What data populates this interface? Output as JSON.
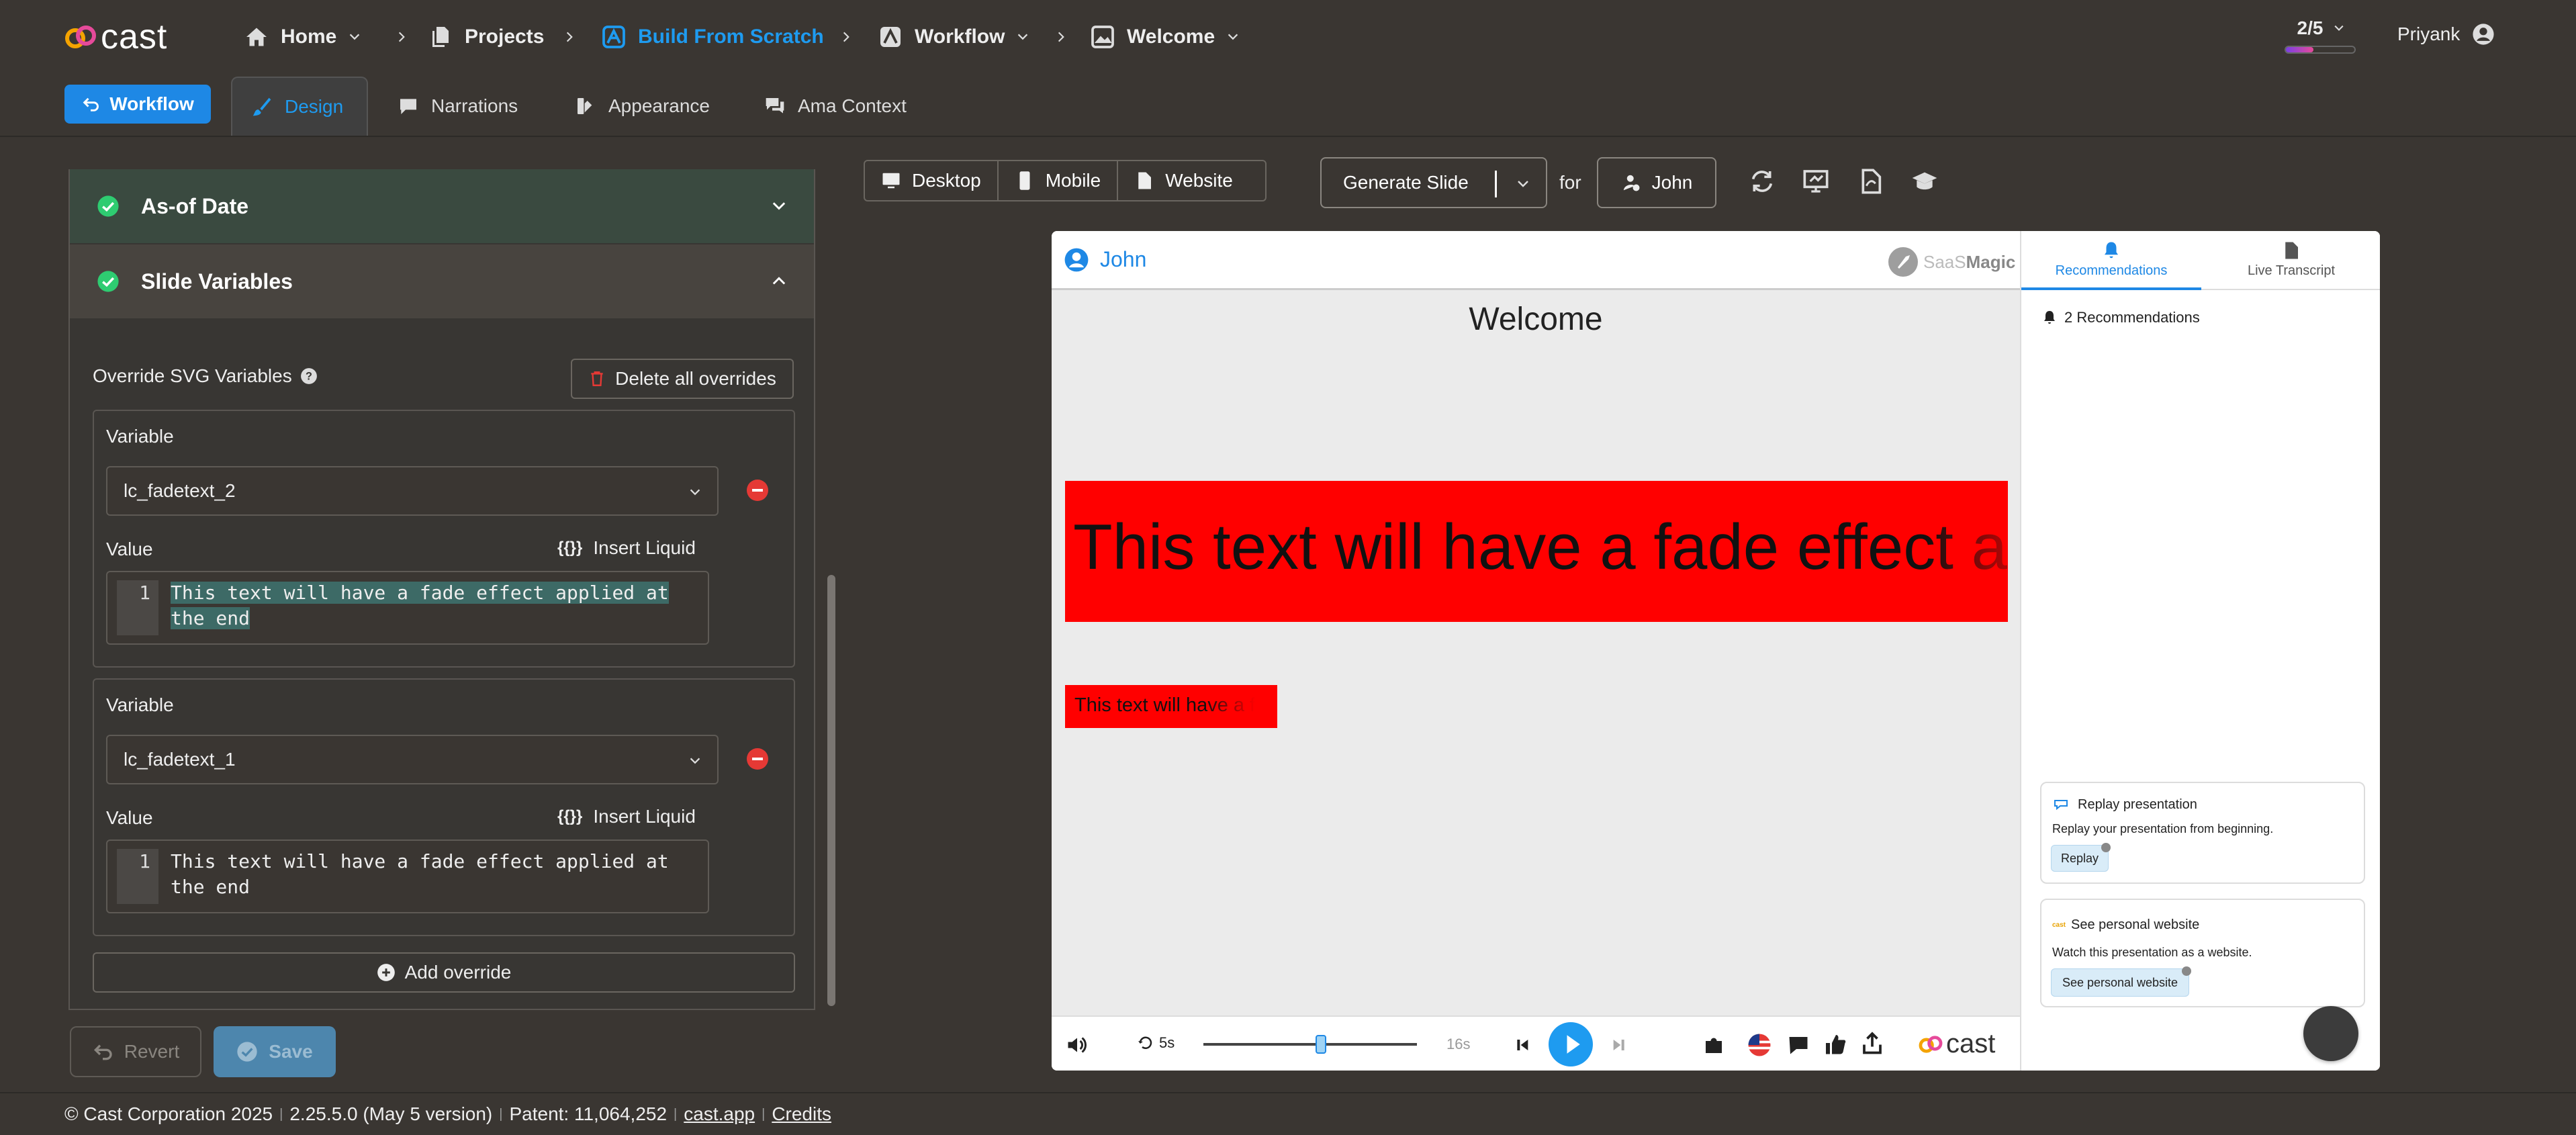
{
  "topbar": {
    "logo": "cast",
    "breadcrumbs": [
      {
        "label": "Home",
        "icon": "home-icon"
      },
      {
        "label": "Projects",
        "icon": "documents-icon"
      },
      {
        "label": "Build From Scratch",
        "icon": "build-icon"
      },
      {
        "label": "Workflow",
        "icon": "workflow-icon"
      },
      {
        "label": "Welcome",
        "icon": "image-icon"
      }
    ],
    "progress_label": "2/5",
    "progress_fraction": 0.4,
    "user_name": "Priyank"
  },
  "tabs": {
    "workflow_button": "Workflow",
    "items": [
      {
        "label": "Design",
        "active": true
      },
      {
        "label": "Narrations"
      },
      {
        "label": "Appearance"
      },
      {
        "label": "Ama Context"
      }
    ]
  },
  "left": {
    "section_asof": "As-of Date",
    "section_vars": "Slide Variables",
    "override_label": "Override SVG Variables",
    "delete_all": "Delete all overrides",
    "variable_label": "Variable",
    "value_label": "Value",
    "insert_liquid": "Insert Liquid",
    "liquid_icon": "{{}}",
    "overrides": [
      {
        "variable": "lc_fadetext_2",
        "line": "1",
        "value_line1": "This text will have a fade effect applied at",
        "value_line2": "the end"
      },
      {
        "variable": "lc_fadetext_1",
        "line": "1",
        "value_line1": "This text will have a fade effect applied at",
        "value_line2": "the end"
      }
    ],
    "add_override": "Add override",
    "revert": "Revert",
    "save": "Save"
  },
  "toolbar": {
    "devices": [
      "Desktop",
      "Mobile",
      "Website"
    ],
    "generate_slide": "Generate Slide",
    "for_label": "for",
    "person": "John"
  },
  "preview": {
    "viewer_name": "John",
    "brand": "SaaSMagic",
    "brand_part1": "SaaS",
    "brand_part2": "Magic",
    "slide_title": "Welcome",
    "big_text": "This text will have a fade effect ap",
    "small_text": "This text will have a f",
    "player": {
      "skip": "5s",
      "duration": "16s",
      "progress": 0.55
    },
    "logo": "cast"
  },
  "sidepane": {
    "tab_recommendations": "Recommendations",
    "tab_transcript": "Live Transcript",
    "count_text": "2 Recommendations",
    "cards": [
      {
        "title": "Replay presentation",
        "desc": "Replay your presentation from beginning.",
        "button": "Replay"
      },
      {
        "title": "See personal website",
        "desc": "Watch this presentation as a website.",
        "button": "See personal website",
        "logo": "cast"
      }
    ]
  },
  "footer": {
    "copyright": "© Cast Corporation 2025",
    "version": "2.25.5.0 (May 5 version)",
    "patent": "Patent: 11,064,252",
    "site": "cast.app",
    "credits": "Credits",
    "separator": "|"
  },
  "colors": {
    "accent": "#1e88e5",
    "danger": "#e53935",
    "success": "#2ecc71",
    "slide_red": "#ff0000"
  }
}
